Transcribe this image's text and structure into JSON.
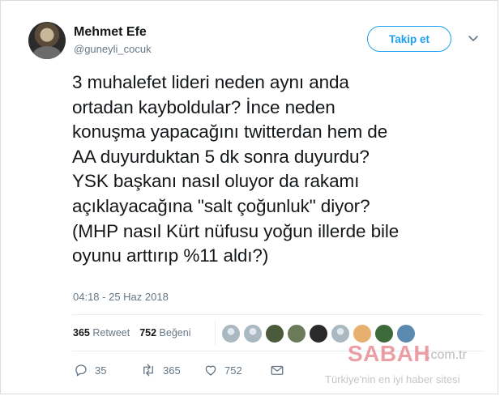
{
  "author": {
    "name": "Mehmet Efe",
    "handle": "@guneyli_cocuk"
  },
  "follow_button": "Takip et",
  "tweet": {
    "text": "3 muhalefet lideri neden aynı anda\nortadan kayboldular? İnce neden\nkonuşma yapacağını twitterdan hem de\nAA duyurduktan 5 dk sonra duyurdu?\nYSK başkanı nasıl oluyor da rakamı\naçıklayacağına \"salt çoğunluk\" diyor?\n(MHP nasıl Kürt nüfusu yoğun illerde bile\noyunu arttırıp %11 aldı?)",
    "timestamp": "04:18 - 25 Haz 2018"
  },
  "stats": {
    "retweets_count": "365",
    "retweets_label": "Retweet",
    "likes_count": "752",
    "likes_label": "Beğeni"
  },
  "likers": [
    {
      "icon": "avatar-default",
      "color": "#aab8c2"
    },
    {
      "icon": "avatar-default",
      "color": "#aab8c2"
    },
    {
      "icon": "avatar-group",
      "color": "#4a5a3a"
    },
    {
      "icon": "avatar-photo",
      "color": "#6b7b5a"
    },
    {
      "icon": "avatar-person",
      "color": "#2a2a2a"
    },
    {
      "icon": "avatar-default",
      "color": "#aab8c2"
    },
    {
      "icon": "avatar-logo",
      "color": "#e8b070"
    },
    {
      "icon": "avatar-landscape",
      "color": "#3d6a3a"
    },
    {
      "icon": "avatar-sky",
      "color": "#5a8ab0"
    }
  ],
  "actions": {
    "replies": "35",
    "retweets": "365",
    "likes": "752"
  },
  "watermark": {
    "brand": "SABAH",
    "tld": ".com.tr",
    "slogan": "Türkiye'nin en iyi haber sitesi"
  },
  "colors": {
    "accent": "#1da1f2",
    "muted": "#657786",
    "watermark_red": "#d22832"
  }
}
